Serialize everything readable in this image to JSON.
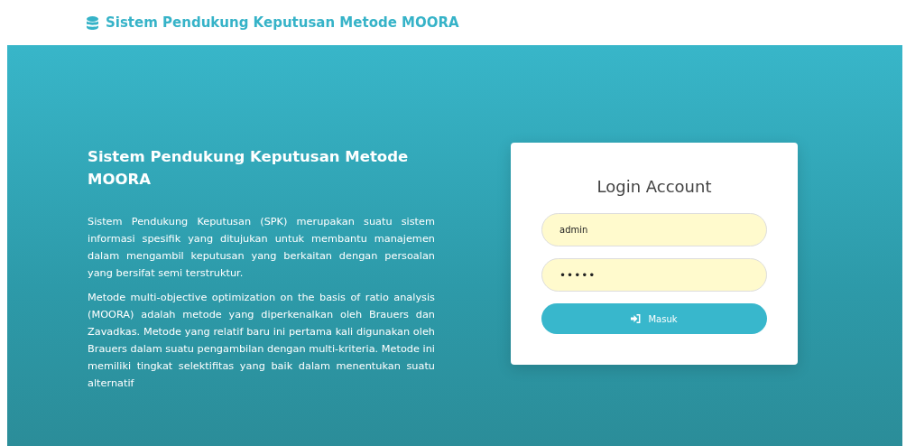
{
  "navbar": {
    "brand": "Sistem Pendukung Keputusan Metode MOORA"
  },
  "hero": {
    "title": "Sistem Pendukung Keputusan Metode MOORA",
    "paragraphs": [
      "Sistem Pendukung Keputusan (SPK) merupakan suatu sistem informasi spesifik yang ditujukan untuk membantu manajemen dalam mengambil keputusan yang berkaitan dengan persoalan yang bersifat semi terstruktur.",
      "Metode multi-objective optimization on the basis of ratio analysis (MOORA) adalah metode yang diperkenalkan oleh Brauers dan Zavadkas. Metode yang relatif baru ini pertama kali digunakan oleh Brauers dalam suatu pengambilan dengan multi-kriteria. Metode ini memiliki tingkat selektifitas yang baik dalam menentukan suatu alternatif"
    ]
  },
  "login": {
    "title": "Login Account",
    "fields": [
      {
        "kind": "text",
        "value": "admin"
      },
      {
        "kind": "password",
        "value": "•••••"
      }
    ],
    "button": "Masuk"
  }
}
